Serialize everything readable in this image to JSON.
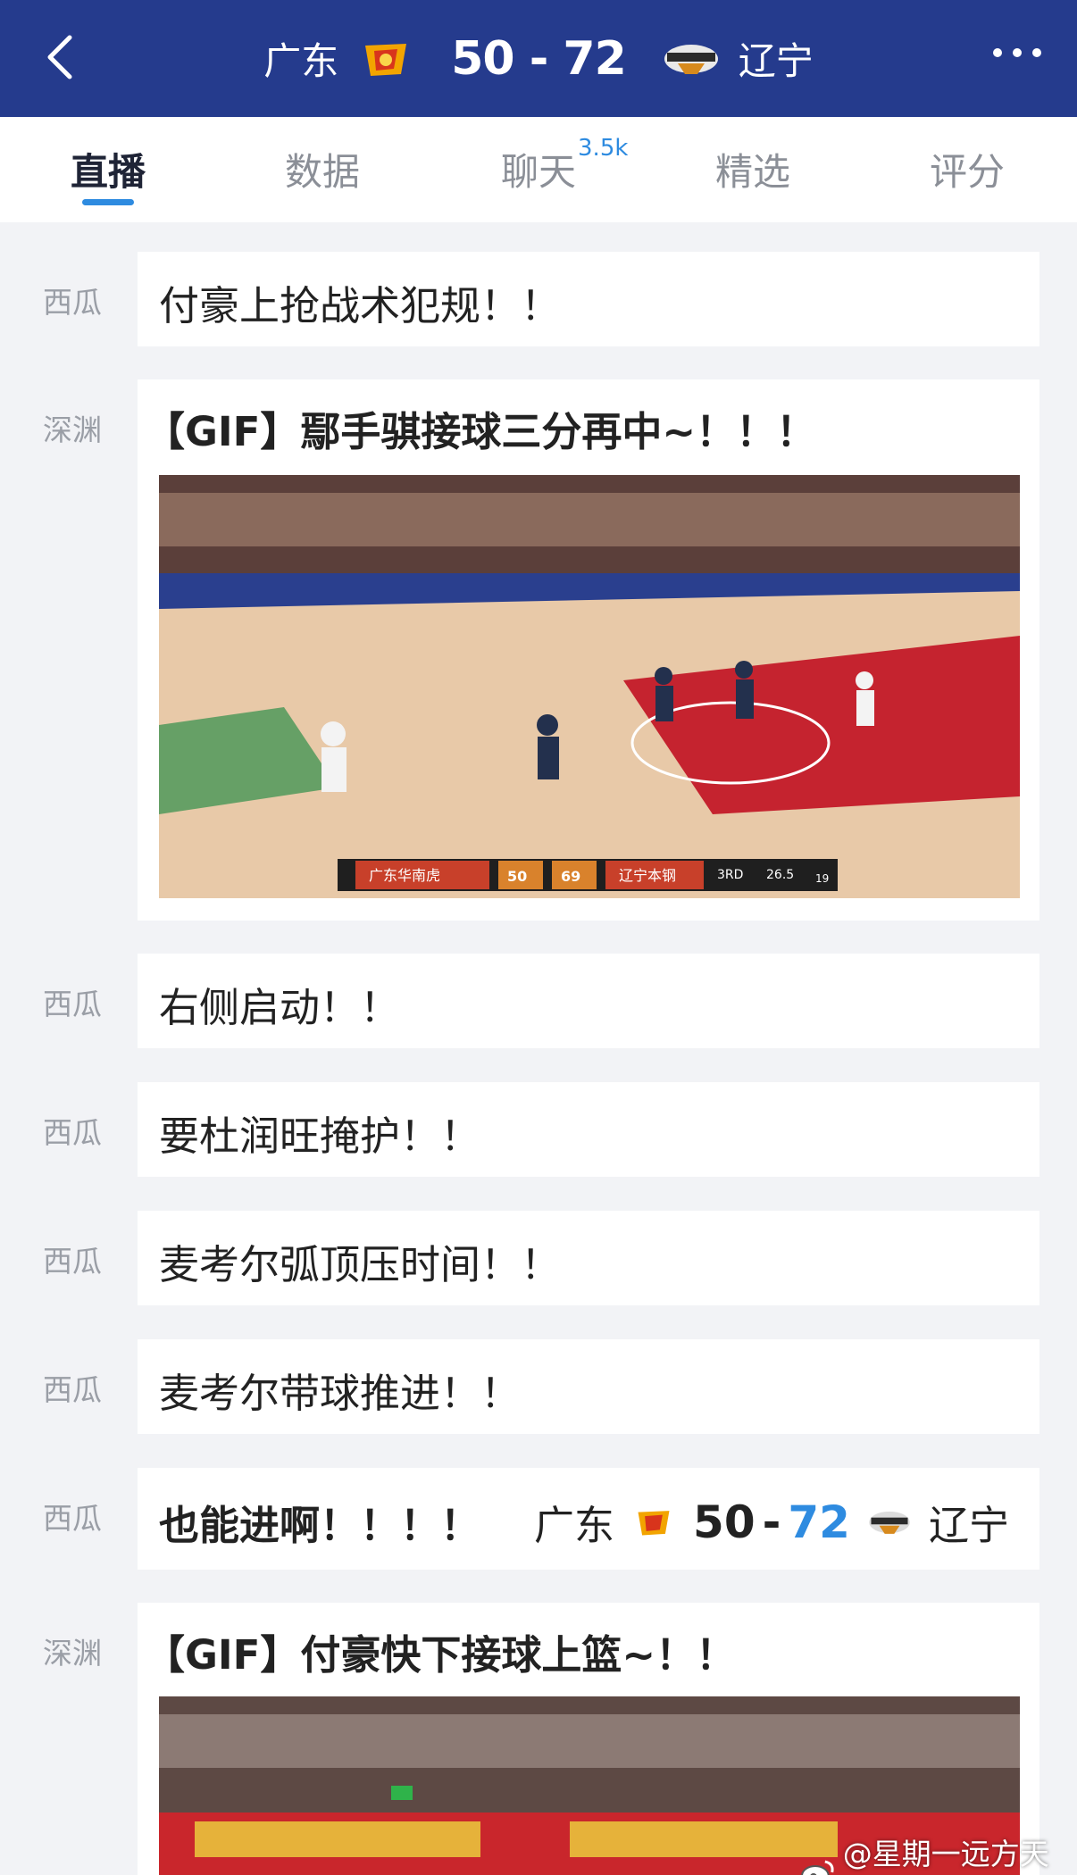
{
  "header": {
    "home_team": "广东",
    "away_team": "辽宁",
    "home_score": "50",
    "dash": "-",
    "away_score": "72"
  },
  "tabs": [
    {
      "label": "直播",
      "active": true
    },
    {
      "label": "数据"
    },
    {
      "label": "聊天",
      "badge": "3.5k"
    },
    {
      "label": "精选"
    },
    {
      "label": "评分"
    }
  ],
  "feed": [
    {
      "author": "西瓜",
      "text": "付豪上抢战术犯规！！"
    },
    {
      "author": "深渊",
      "text": "【GIF】鄢手骐接球三分再中~！！！",
      "has_gif": true,
      "gif_scoreboard": {
        "home": "广东华南虎",
        "home_score": "50",
        "away_score": "69",
        "away": "辽宁本钢",
        "period": "3RD",
        "clock": "26.5",
        "shot": "19"
      }
    },
    {
      "author": "西瓜",
      "text": "右侧启动！！"
    },
    {
      "author": "西瓜",
      "text": "要杜润旺掩护！！"
    },
    {
      "author": "西瓜",
      "text": "麦考尔弧顶压时间！！"
    },
    {
      "author": "西瓜",
      "text": "麦考尔带球推进！！"
    },
    {
      "author": "西瓜",
      "text": "也能进啊！！！！",
      "score": {
        "home": "广东",
        "home_score": "50",
        "dash": "-",
        "away_score": "72",
        "away": "辽宁"
      }
    },
    {
      "author": "深渊",
      "text": "【GIF】付豪快下接球上篮~！！",
      "has_gif": true
    }
  ],
  "watermark": "@星期一远方天晴",
  "colors": {
    "header_bg": "#253b8d",
    "accent": "#2e8be0",
    "page_bg": "#f2f3f6"
  }
}
